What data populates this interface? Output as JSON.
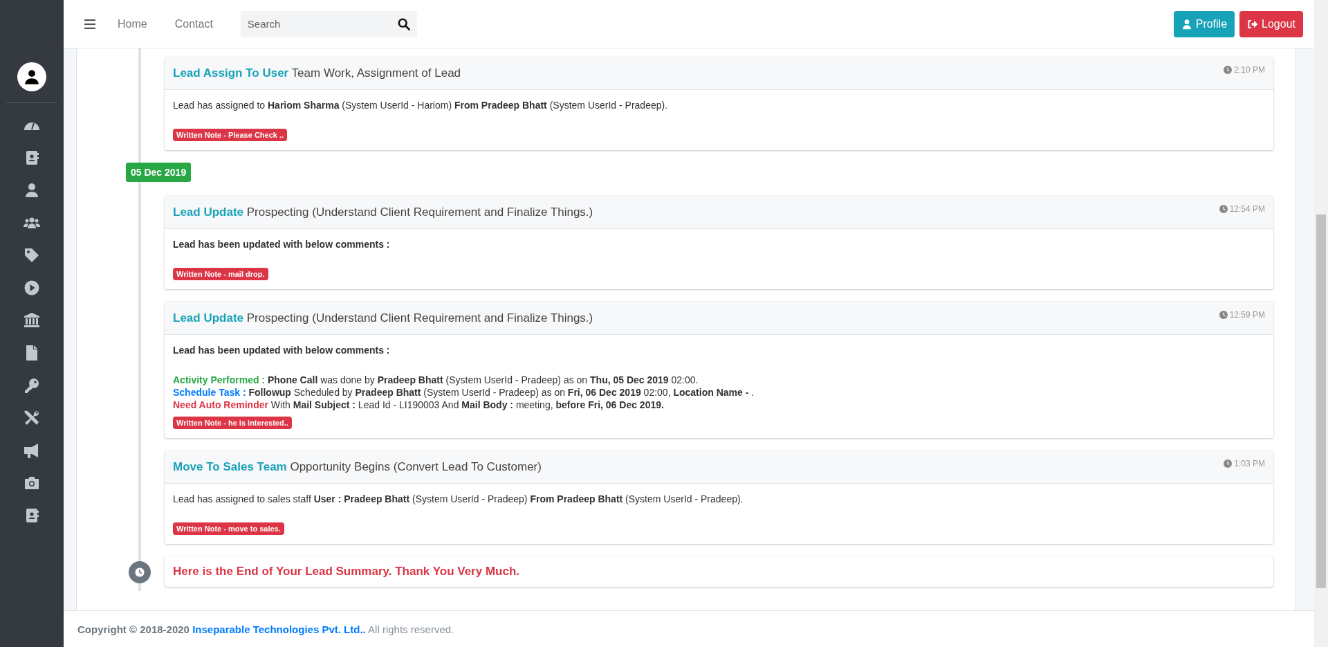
{
  "header": {
    "nav": [
      "Home",
      "Contact"
    ],
    "search": {
      "placeholder": "Search"
    },
    "buttons": [
      {
        "kind": "profile",
        "label": "Profile"
      },
      {
        "kind": "logout",
        "label": "Logout"
      }
    ]
  },
  "timeline": [
    {
      "kind": "event",
      "title": "Lead Assign To User",
      "subtitle": "Team Work, Assignment of Lead",
      "time": "2:10 PM",
      "lines": [
        {
          "kind": "plain",
          "text": "Lead has assigned to **Hariom Sharma** (System UserId - Hariom) **From Pradeep Bhatt** (System UserId - Pradeep)."
        }
      ],
      "note": "Written Note - Please Check .."
    },
    {
      "kind": "date",
      "text": "05 Dec 2019"
    },
    {
      "kind": "event",
      "title": "Lead Update",
      "subtitle": "Prospecting (Understand Client Requirement and Finalize Things.)",
      "time": "12:54 PM",
      "lines": [
        {
          "kind": "heading",
          "text": "Lead has been updated with below comments :"
        }
      ],
      "note": "Written Note - mail drop."
    },
    {
      "kind": "event",
      "title": "Lead Update",
      "subtitle": "Prospecting (Understand Client Requirement and Finalize Things.)",
      "time": "12:59 PM",
      "lines": [
        {
          "kind": "heading",
          "text": "Lead has been updated with below comments :"
        },
        {
          "kind": "activity",
          "label": "Activity Performed :",
          "text": "**Phone Call** was done by **Pradeep Bhatt** (System UserId - Pradeep) as on **Thu, 05 Dec 2019** 02:00."
        },
        {
          "kind": "schedule",
          "label": "Schedule Task :",
          "text": "**Followup** Scheduled by **Pradeep Bhatt** (System UserId - Pradeep) as on **Fri, 06 Dec 2019** 02:00, **Location Name -** ."
        },
        {
          "kind": "reminder",
          "label": "Need Auto Reminder",
          "text": "With **Mail Subject :** Lead Id - LI190003 And **Mail Body :** meeting, **before Fri, 06 Dec 2019.**"
        }
      ],
      "note": "Written Note - he is interested.."
    },
    {
      "kind": "event",
      "title": "Move To Sales Team",
      "subtitle": "Opportunity Begins (Convert Lead To Customer)",
      "time": "1:03 PM",
      "lines": [
        {
          "kind": "plain",
          "text": "Lead has assigned to sales staff **User : Pradeep Bhatt** (System UserId - Pradeep) **From Pradeep Bhatt** (System UserId - Pradeep)."
        }
      ],
      "note": "Written Note - move to sales."
    },
    {
      "kind": "end",
      "text": "Here is the End of Your Lead Summary. Thank You Very Much."
    }
  ],
  "footer": {
    "prefix": "Copyright © 2018-2020",
    "link": "Inseparable Technologies Pvt. Ltd..",
    "suffix": "All rights reserved."
  }
}
